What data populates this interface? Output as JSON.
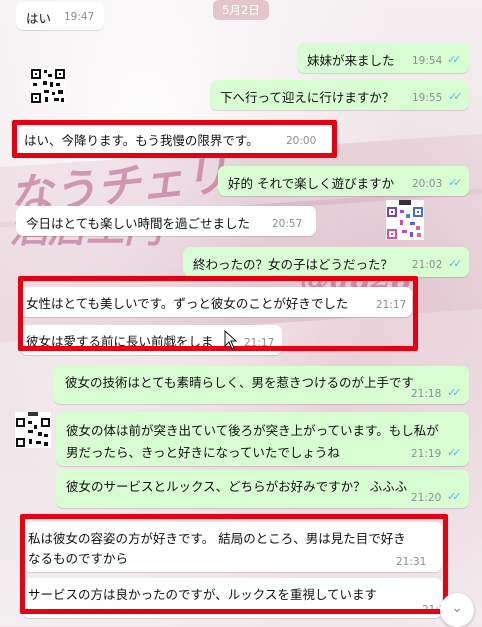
{
  "date_label": "5月2日",
  "messages": [
    {
      "text": "はい",
      "time": "19:47"
    },
    {
      "text": "妹妹が来ました",
      "time": "19:54"
    },
    {
      "text": "下へ行って迎えに行けますか？",
      "time": "19:55"
    },
    {
      "text": "はい、今降ります。もう我慢の限界です。",
      "time": "20:00"
    },
    {
      "text": "好的 それで楽しく遊びますか",
      "time": "20:03"
    },
    {
      "text": "今日はとても楽しい時間を過ごせました",
      "time": "20:57"
    },
    {
      "text": "終わったの？女の子はどうだった？",
      "time": "21:02"
    },
    {
      "text": "女性はとても美しいです。ずっと彼女のことが好きでした",
      "time": "21:17"
    },
    {
      "text": "彼女は愛する前に長い前戯をしま",
      "time": "21:17"
    },
    {
      "text": "彼女の技術はとても素晴らしく、男を惹きつけるのが上手です",
      "time": "21:18"
    },
    {
      "text": "彼女の体は前が突き出ていて後ろが突き上がっています。もし私が",
      "text2": "男だったら、きっと好きになっていたでしょうね",
      "time": "21:19"
    },
    {
      "text": "彼女のサービスとルックス、どちらがお好みですか？ ふふふ",
      "time": "21:20"
    },
    {
      "text": "私は彼女の容姿の方が好きです。 結局のところ、男は見た目で好き",
      "text2": "なるものですから",
      "time": "21:31"
    },
    {
      "text": "サービスの方は良かったのですが、ルックスを重視しています",
      "time": "21:32"
    }
  ],
  "colors": {
    "incoming": "#ffffff",
    "outgoing": "#d9fdd3",
    "highlight_box": "#e50012",
    "read_ticks": "#53bdeb"
  },
  "icons": {
    "read": "double-check-icon",
    "scroll": "chevron-down-icon",
    "qr": "qr-code-image"
  }
}
